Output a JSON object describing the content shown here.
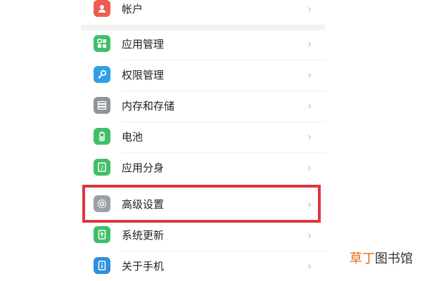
{
  "settings_list": {
    "items": [
      {
        "label": "帐户",
        "icon": "account-icon",
        "color": "#ee5b4f"
      },
      {
        "label": "应用管理",
        "icon": "apps-grid-icon",
        "color": "#3fbf68"
      },
      {
        "label": "权限管理",
        "icon": "key-icon",
        "color": "#2fa0e6"
      },
      {
        "label": "内存和存储",
        "icon": "storage-icon",
        "color": "#8e9399"
      },
      {
        "label": "电池",
        "icon": "battery-icon",
        "color": "#3fbf68"
      },
      {
        "label": "应用分身",
        "icon": "app-clone-icon",
        "color": "#3fbf68"
      },
      {
        "label": "高级设置",
        "icon": "gear-icon",
        "color": "#9aa0a6"
      },
      {
        "label": "系统更新",
        "icon": "system-update-icon",
        "color": "#3fbf68"
      },
      {
        "label": "关于手机",
        "icon": "about-phone-icon",
        "color": "#2f8fe0"
      }
    ],
    "chevron": "›",
    "highlighted_item": "高级设置"
  },
  "watermark": {
    "brand": "草丁",
    "rest": "图书馆"
  },
  "colors": {
    "highlight_border": "#e0353f",
    "divider": "#f2f2f2"
  }
}
